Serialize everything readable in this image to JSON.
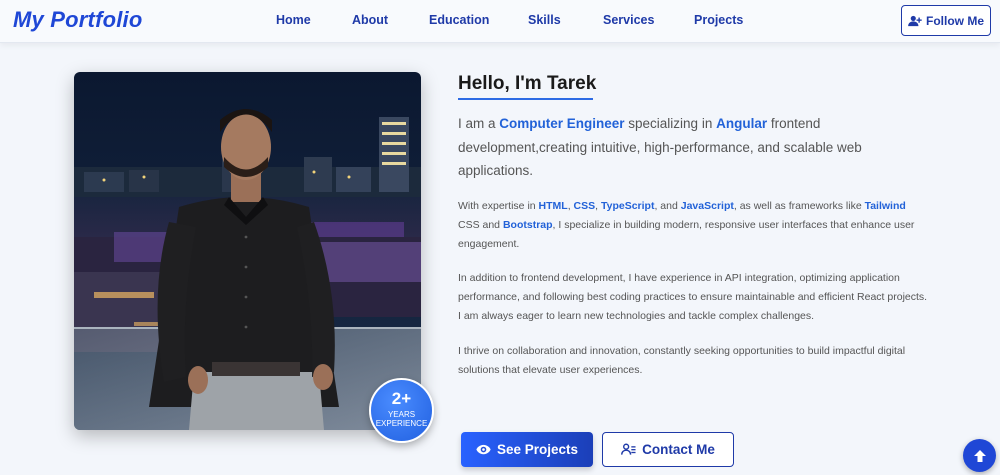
{
  "nav": {
    "brand": "My Portfolio",
    "links": [
      "Home",
      "About",
      "Education",
      "Skills",
      "Services",
      "Projects"
    ],
    "follow_label": "Follow Me"
  },
  "about": {
    "greeting": "Hello, I'm Tarek",
    "lead": {
      "t1": "I am a ",
      "role": "Computer Engineer",
      "t2": " specializing in ",
      "framework": "Angular",
      "t3": " frontend development,creating intuitive, high-performance, and scalable web applications."
    },
    "p1": {
      "t1": "With expertise in ",
      "html": "HTML",
      "c1": ", ",
      "css": "CSS",
      "c2": ", ",
      "ts": "TypeScript",
      "c3": ", and ",
      "js": "JavaScript",
      "t2": ", as well as frameworks like ",
      "tailwind": "Tailwind",
      "t3": " CSS and ",
      "bootstrap": "Bootstrap",
      "t4": ", I specialize in building modern, responsive user interfaces that enhance user engagement."
    },
    "p2": "In addition to frontend development, I have experience in API integration, optimizing application performance, and following best coding practices to ensure maintainable and efficient React projects. I am always eager to learn new technologies and tackle complex challenges.",
    "p3": "I thrive on collaboration and innovation, constantly seeking opportunities to build impactful digital solutions that elevate user experiences.",
    "experience": {
      "value": "2+",
      "label_line1": "YEARS",
      "label_line2": "EXPERIENCE"
    },
    "btn_projects": "See Projects",
    "btn_contact": "Contact Me"
  },
  "colors": {
    "accent": "#2262d8",
    "brand": "#1f47d6",
    "nav_text": "#1f3aa8",
    "background": "#f3f6fb"
  },
  "icons": {
    "follow": "user-plus-icon",
    "projects": "eye-icon",
    "contact": "users-icon",
    "scroll_top": "arrow-up-icon"
  }
}
